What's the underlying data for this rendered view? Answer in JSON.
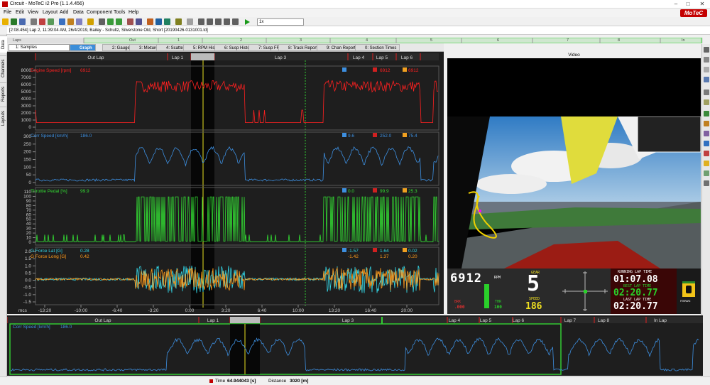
{
  "app": {
    "title": "Circuit - MoTeC i2 Pro (1.1.4.456)",
    "logo": "MoTeC"
  },
  "menu": [
    "File",
    "Edit",
    "View",
    "Layout",
    "Add",
    "Data",
    "Component",
    "Tools",
    "Help"
  ],
  "toolbar": {
    "zoom_value": "1x"
  },
  "session": {
    "text": "[2:08.454] Lap 2, 11:39:04 AM, 26/4/2019, Bailey - Schultz, Silverstone Old, Short [20190426-0131001.ld]"
  },
  "top_laps": {
    "labels": [
      "Laps",
      "Out",
      "1",
      "2",
      "3",
      "4",
      "5",
      "6",
      "7",
      "8",
      "In"
    ]
  },
  "left_tabs": [
    "Data",
    "Channels",
    "Reports",
    "Layouts"
  ],
  "worksheet": {
    "selector": "1: Samples",
    "tabs": [
      "Graph",
      "2: Gauges",
      "3: Mixture",
      "4: Scatter",
      "5: RPM Histo",
      "6: Susp Histo",
      "7: Susp FFT",
      "8: Track Report",
      "9: Chan Report",
      "0: Section Times"
    ]
  },
  "graph": {
    "lap_labels": [
      "Out Lap",
      "Lap 1",
      "Lap 2",
      "Lap 3",
      "Lap 4",
      "Lap 5",
      "Lap 6"
    ],
    "xaxis_unit": "mcs",
    "xticks": [
      "-13:20",
      "-10:00",
      "-6:40",
      "-3:20",
      "0:00",
      "3:20",
      "6:40",
      "10:00",
      "13:20",
      "16:40",
      "20:00"
    ],
    "panes": [
      {
        "name": "Engine Speed [rpm]",
        "value": "6912",
        "color": "#ff2020",
        "ticks": [
          "8000",
          "7000",
          "6000",
          "5000",
          "4000",
          "3000",
          "2000",
          "1000",
          "0"
        ],
        "stats": [
          "",
          "6912",
          "6912"
        ]
      },
      {
        "name": "Corr Speed [km/h]",
        "value": "186.0",
        "color": "#3d8fe0",
        "ticks": [
          "300",
          "250",
          "200",
          "150",
          "100",
          "50",
          "0"
        ],
        "stats": [
          "9.6",
          "252.0",
          "75.4"
        ]
      },
      {
        "name": "Throttle Pedal [%]",
        "value": "99.9",
        "color": "#33dd33",
        "ticks": [
          "110",
          "100",
          "90",
          "80",
          "70",
          "60",
          "50",
          "40",
          "30",
          "20",
          "10",
          "0"
        ],
        "stats": [
          "0.0",
          "99.9",
          "25.3"
        ]
      },
      {
        "name": "G Force Lat [G]",
        "value": "0.28",
        "color": "#33d6e6",
        "ticks": [
          "2.0",
          "1.5",
          "1.0",
          "0.5",
          "0.0",
          "-0.5",
          "-1.0",
          "-1.5"
        ],
        "stats": [
          "-1.57",
          "1.64",
          "0.02"
        ]
      },
      {
        "name": "G Force Long [G]",
        "value": "0.42",
        "color": "#ff9a1a",
        "ticks": [],
        "stats": [
          "-1.42",
          "1.37",
          "0.20"
        ]
      }
    ]
  },
  "video": {
    "header": "Video",
    "rpm": "6912",
    "rpm_unit": "RPM",
    "gear_label": "GEAR",
    "gear": "5",
    "speed_label": "SPEED",
    "speed": "186",
    "brk_label": "BRK",
    "brk": ".000",
    "thr_label": "THR",
    "thr": "100",
    "running_label": "RUNNING LAP TIME",
    "running": "01:07.08",
    "best_label": "BEST LAP TIME",
    "best": "02:20.77",
    "last_label": "LAST LAP TIME",
    "last": "02:20.77",
    "badge": "FERRARI"
  },
  "lower": {
    "lap_labels": [
      "Out Lap",
      "Lap 1",
      "Lap 2",
      "Lap 3",
      "Lap 4",
      "Lap 5",
      "Lap 6",
      "Lap 7",
      "Lap 8",
      "In Lap"
    ],
    "channel": "Corr Speed [km/h]",
    "value": "186.0"
  },
  "status": {
    "time_label": "Time",
    "time": "64.944043 [s]",
    "dist_label": "Distance",
    "dist": "3020 [m]"
  },
  "colors": {
    "rpm": "#ff2020",
    "speed": "#3d8fe0",
    "throttle": "#33dd33",
    "glat": "#33d6e6",
    "glong": "#ff9a1a",
    "accent": "#3c8dd9",
    "lapgreen": "#33cc33"
  }
}
